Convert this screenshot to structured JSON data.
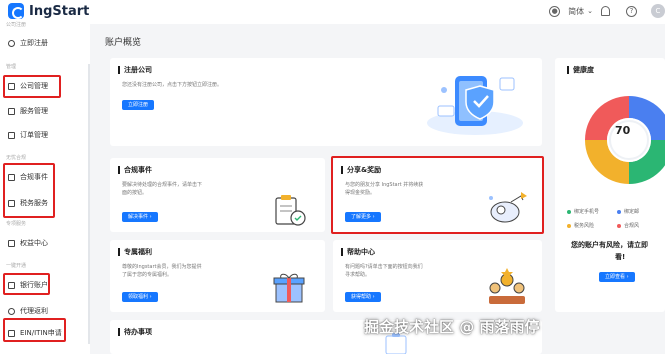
{
  "app": {
    "name": "IngStart"
  },
  "topbar": {
    "language": "简体",
    "avatar_initial": "C"
  },
  "sidebar": {
    "groups": [
      "公司注册",
      "管理",
      "无忧合规",
      "专项服务",
      "一键开通"
    ],
    "items": [
      {
        "label": "立即注册",
        "icon": "user-icon"
      },
      {
        "label": "公司管理",
        "icon": "building-icon"
      },
      {
        "label": "服务管理",
        "icon": "bag-icon"
      },
      {
        "label": "订单管理",
        "icon": "doc-icon"
      },
      {
        "label": "合规事件",
        "icon": "calendar-icon"
      },
      {
        "label": "税务服务",
        "icon": "file-icon"
      },
      {
        "label": "权益中心",
        "icon": "gift-icon"
      },
      {
        "label": "银行账户",
        "icon": "bank-icon"
      },
      {
        "label": "代理返利",
        "icon": "share-icon"
      },
      {
        "label": "EIN/ITIN申请",
        "icon": "id-card-icon"
      }
    ]
  },
  "main": {
    "title": "账户概览",
    "register": {
      "title": "注册公司",
      "desc": "您还没有注册公司，点击下方按钮立即注册。",
      "button": "立即注册"
    },
    "compliance": {
      "title": "合规事件",
      "desc1": "要解决待处理的合规事件，请单击下",
      "desc2": "面的按钮。",
      "button": "解决事件 ›"
    },
    "share": {
      "title": "分享&奖励",
      "desc1": "与您的朋友分享 IngStart 并将续获",
      "desc2": "得现金奖励。",
      "button": "了解更多 ›"
    },
    "benefits": {
      "title": "专属福利",
      "desc1": "尊敬的Ingstart会员，我们为您提供",
      "desc2": "了属于您的专属福利。",
      "button": "领取福利 ›"
    },
    "help": {
      "title": "帮助中心",
      "desc1": "有问题吗?请单击下面的按钮向我们",
      "desc2": "寻求帮助。",
      "button": "获得帮助 ›"
    },
    "todo": {
      "title": "待办事项"
    },
    "health": {
      "title": "健康度",
      "score": "70",
      "legend": [
        "绑定手机号",
        "绑定邮",
        "税务风险",
        "合规风"
      ],
      "risk_line1": "您的账户有风险，请立即",
      "risk_line2": "看!",
      "button": "立即查看 ›",
      "colors": {
        "blue": "#4a7ff0",
        "red": "#f05a5a",
        "yellow": "#f2b12c",
        "green": "#2bb673"
      }
    }
  },
  "watermark": "掘金技术社区 @ 雨落雨停"
}
